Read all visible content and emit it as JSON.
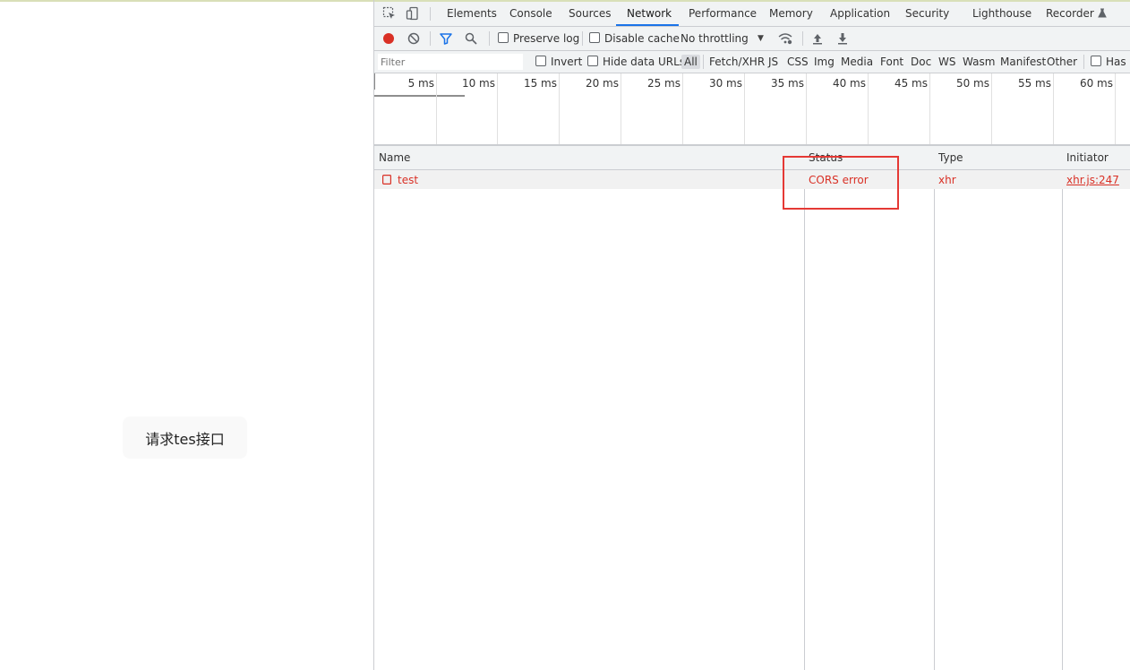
{
  "page": {
    "button_label": "请求tes接口"
  },
  "devtools": {
    "tabs": [
      "Elements",
      "Console",
      "Sources",
      "Network",
      "Performance",
      "Memory",
      "Application",
      "Security",
      "Lighthouse",
      "Recorder"
    ],
    "active_tab": "Network",
    "toolbar": {
      "preserve_log": "Preserve log",
      "disable_cache": "Disable cache",
      "throttling": "No throttling"
    },
    "filter": {
      "placeholder": "Filter",
      "invert": "Invert",
      "hide_data_urls": "Hide data URLs",
      "types": [
        "All",
        "Fetch/XHR",
        "JS",
        "CSS",
        "Img",
        "Media",
        "Font",
        "Doc",
        "WS",
        "Wasm",
        "Manifest",
        "Other"
      ],
      "has_label": "Has b"
    },
    "timeline_ticks": [
      "5 ms",
      "10 ms",
      "15 ms",
      "20 ms",
      "25 ms",
      "30 ms",
      "35 ms",
      "40 ms",
      "45 ms",
      "50 ms",
      "55 ms",
      "60 ms"
    ],
    "columns": [
      "Name",
      "Status",
      "Type",
      "Initiator"
    ],
    "rows": [
      {
        "name": "test",
        "status": "CORS error",
        "type": "xhr",
        "initiator": "xhr.js:247"
      }
    ],
    "colors": {
      "error": "#d93025",
      "accent": "#1a73e8",
      "highlight_box": "#e53935"
    }
  }
}
